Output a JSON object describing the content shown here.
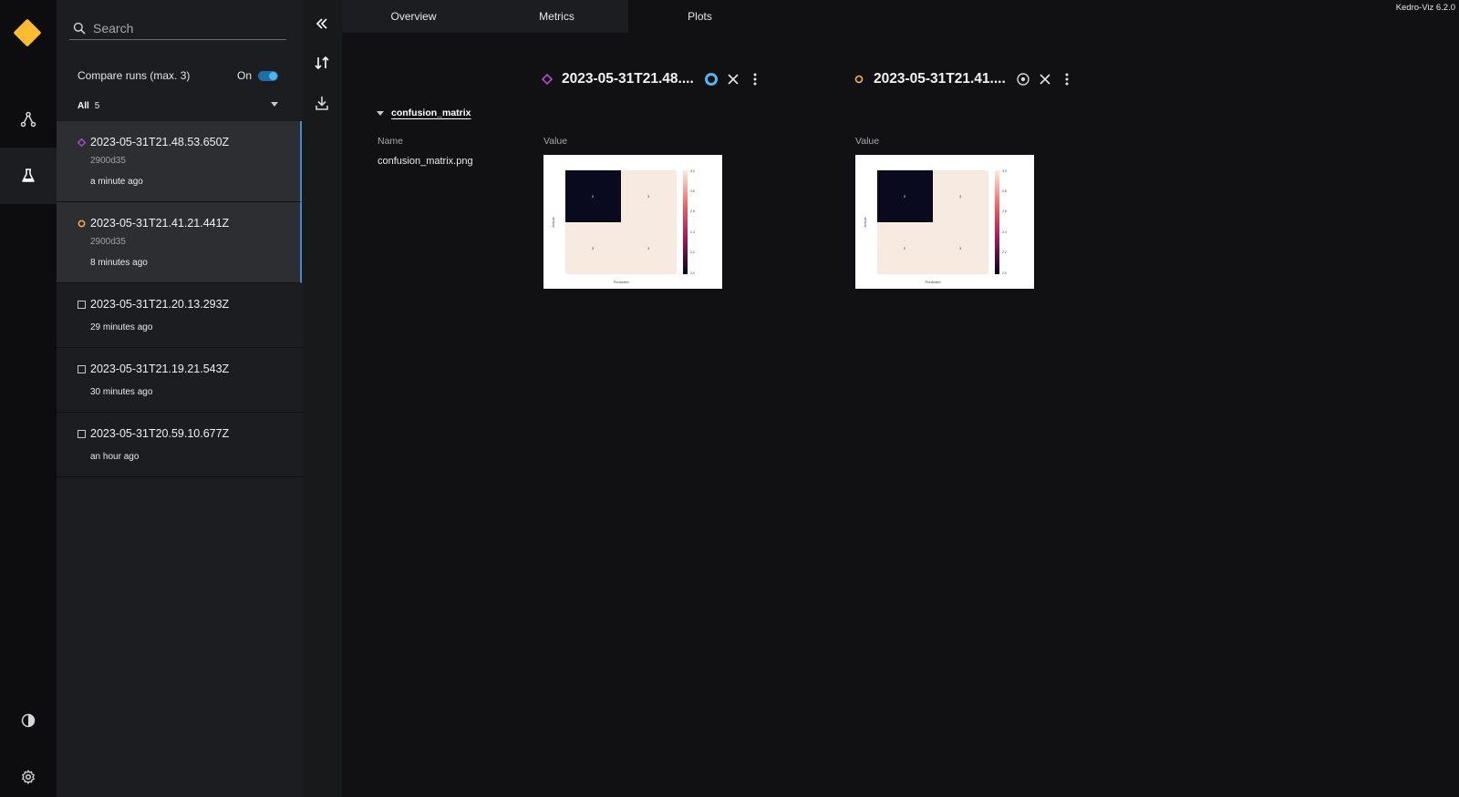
{
  "app": {
    "version_label": "Kedro-Viz 6.2.0",
    "brand_color": "#ffbc2e",
    "accent_color": "#4fb7ef"
  },
  "global_nav": {
    "items": [
      {
        "icon": "flowchart-icon",
        "active": false
      },
      {
        "icon": "experiment-flask-icon",
        "active": true
      },
      {
        "icon": "theme-toggle-icon",
        "active": false
      },
      {
        "icon": "settings-gear-icon",
        "active": false
      }
    ]
  },
  "sidebar": {
    "search": {
      "placeholder": "Search",
      "value": ""
    },
    "compare": {
      "label": "Compare runs (max. 3)",
      "toggle_label": "On",
      "enabled": true
    },
    "filter": {
      "label": "All",
      "count": "5"
    },
    "runs": [
      {
        "title": "2023-05-31T21.48.53.650Z",
        "hash": "2900d35",
        "time": "a minute ago",
        "marker": "diamond",
        "marker_color": "#b34fcf",
        "selected": true
      },
      {
        "title": "2023-05-31T21.41.21.441Z",
        "hash": "2900d35",
        "time": "8 minutes ago",
        "marker": "circle",
        "marker_color": "#ffb340",
        "selected": true
      },
      {
        "title": "2023-05-31T21.20.13.293Z",
        "time": "29 minutes ago",
        "marker": "square",
        "selected": false
      },
      {
        "title": "2023-05-31T21.19.21.543Z",
        "time": "30 minutes ago",
        "marker": "square",
        "selected": false
      },
      {
        "title": "2023-05-31T20.59.10.677Z",
        "time": "an hour ago",
        "marker": "square",
        "selected": false
      }
    ]
  },
  "actions": [
    {
      "icon": "collapse-double-chevron-icon"
    },
    {
      "icon": "swap-sort-arrows-icon"
    },
    {
      "icon": "download-icon"
    }
  ],
  "tabs": [
    {
      "label": "Overview",
      "active": false
    },
    {
      "label": "Metrics",
      "active": false
    },
    {
      "label": "Plots",
      "active": true
    }
  ],
  "compare_headers": [
    {
      "title": "2023-05-31T21.48....",
      "marker": "diamond",
      "marker_color": "#b34fcf",
      "pin_active": true
    },
    {
      "title": "2023-05-31T21.41....",
      "marker": "circle",
      "marker_color": "#ffb340",
      "pin_active": false
    }
  ],
  "plots_section": {
    "title": "confusion_matrix",
    "name_header": "Name",
    "value_header": "Value",
    "row_name": "confusion_matrix.png",
    "images": [
      {
        "axis_x": "Predicted",
        "axis_y": "Actual",
        "cells": [
          "2",
          "3",
          "3",
          "3"
        ],
        "scale": [
          "3.0",
          "2.8",
          "2.6",
          "2.4",
          "2.2",
          "2.0"
        ]
      },
      {
        "axis_x": "Predicted",
        "axis_y": "Actual",
        "cells": [
          "2",
          "3",
          "2",
          "3"
        ],
        "scale": [
          "3.0",
          "2.8",
          "2.6",
          "2.4",
          "2.2",
          "2.0"
        ]
      }
    ]
  }
}
